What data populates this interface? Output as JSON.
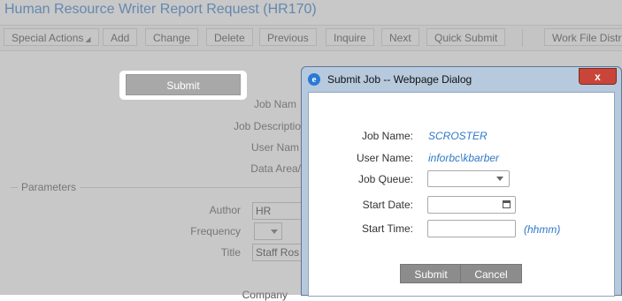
{
  "page": {
    "title": "Human Resource Writer Report Request (HR170)",
    "toolbar": {
      "special_actions": "Special Actions",
      "add": "Add",
      "change": "Change",
      "delete": "Delete",
      "previous": "Previous",
      "inquire": "Inquire",
      "next": "Next",
      "quick_submit": "Quick Submit",
      "work_file": "Work File Distr"
    },
    "submit_label": "Submit",
    "labels": {
      "job_name": "Job Nam",
      "job_description": "Job Descriptio",
      "user_name": "User Nam",
      "data_area": "Data Area/"
    },
    "parameters_title": "Parameters",
    "params": {
      "author_label": "Author",
      "author_value": "HR",
      "frequency_label": "Frequency",
      "title_label": "Title",
      "title_value": "Staff Ros",
      "company_label": "Company"
    }
  },
  "dialog": {
    "title": "Submit Job -- Webpage Dialog",
    "close_label": "x",
    "job_name_label": "Job Name:",
    "job_name_value": "SCROSTER",
    "user_name_label": "User Name:",
    "user_name_value": "inforbc\\kbarber",
    "job_queue_label": "Job Queue:",
    "job_queue_value": "",
    "start_date_label": "Start Date:",
    "start_date_value": "",
    "start_time_label": "Start Time:",
    "start_time_value": "",
    "start_time_hint": "(hhmm)",
    "submit_label": "Submit",
    "cancel_label": "Cancel"
  },
  "colors": {
    "accent_blue": "#2f77c8",
    "close_red": "#c9453a",
    "button_gray": "#8c8c8c"
  }
}
